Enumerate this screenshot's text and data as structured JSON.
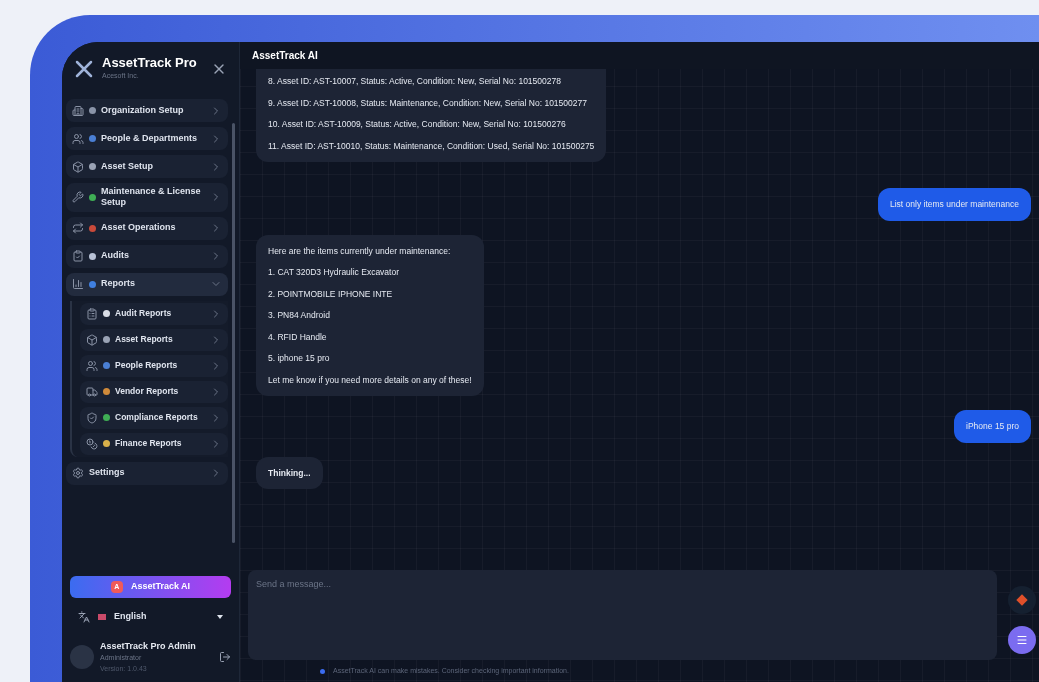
{
  "sidebar": {
    "app_name": "AssetTrack Pro",
    "company": "Acesoft Inc.",
    "items": [
      {
        "label": "Organization Setup",
        "expanded": false
      },
      {
        "label": "People & Departments",
        "expanded": false
      },
      {
        "label": "Asset Setup",
        "expanded": false
      },
      {
        "label": "Maintenance & License Setup",
        "expanded": false
      },
      {
        "label": "Asset Operations",
        "expanded": false
      },
      {
        "label": "Audits",
        "expanded": false
      },
      {
        "label": "Reports",
        "expanded": true,
        "children": [
          {
            "label": "Audit Reports"
          },
          {
            "label": "Asset Reports"
          },
          {
            "label": "People Reports"
          },
          {
            "label": "Vendor Reports"
          },
          {
            "label": "Compliance Reports"
          },
          {
            "label": "Finance Reports"
          }
        ]
      },
      {
        "label": "Settings",
        "expanded": false
      }
    ],
    "ai_button": "AssetTrack AI",
    "ai_badge": "A",
    "language": "English",
    "user": {
      "name": "AssetTrack Pro Admin",
      "role": "Administrator",
      "version": "Version: 1.0.43"
    }
  },
  "chat": {
    "title": "AssetTrack AI",
    "messages": [
      {
        "kind": "assistant",
        "lines": [
          "8. Asset ID: AST-10007, Status: Active, Condition: New, Serial No: 101500278",
          "9. Asset ID: AST-10008, Status: Maintenance, Condition: New, Serial No: 101500277",
          "10. Asset ID: AST-10009, Status: Active, Condition: New, Serial No: 101500276",
          "11. Asset ID: AST-10010, Status: Maintenance, Condition: Used, Serial No: 101500275"
        ]
      },
      {
        "kind": "user",
        "lines": [
          "List only items under maintenance"
        ]
      },
      {
        "kind": "assistant",
        "lines": [
          "Here are the items currently under maintenance:",
          "1. CAT 320D3 Hydraulic Excavator",
          "2. POINTMOBILE IPHONE INTE",
          "3. PN84 Android",
          "4. RFID Handle",
          "5. iphone 15 pro",
          "Let me know if you need more details on any of these!"
        ]
      },
      {
        "kind": "user",
        "lines": [
          "iPhone 15 pro"
        ]
      },
      {
        "kind": "assistant",
        "lines": [
          "Thinking..."
        ]
      }
    ],
    "input": {
      "placeholder": "Send a message..."
    },
    "disclaimer": "AssetTrack AI can make mistakes. Consider checking important information."
  }
}
